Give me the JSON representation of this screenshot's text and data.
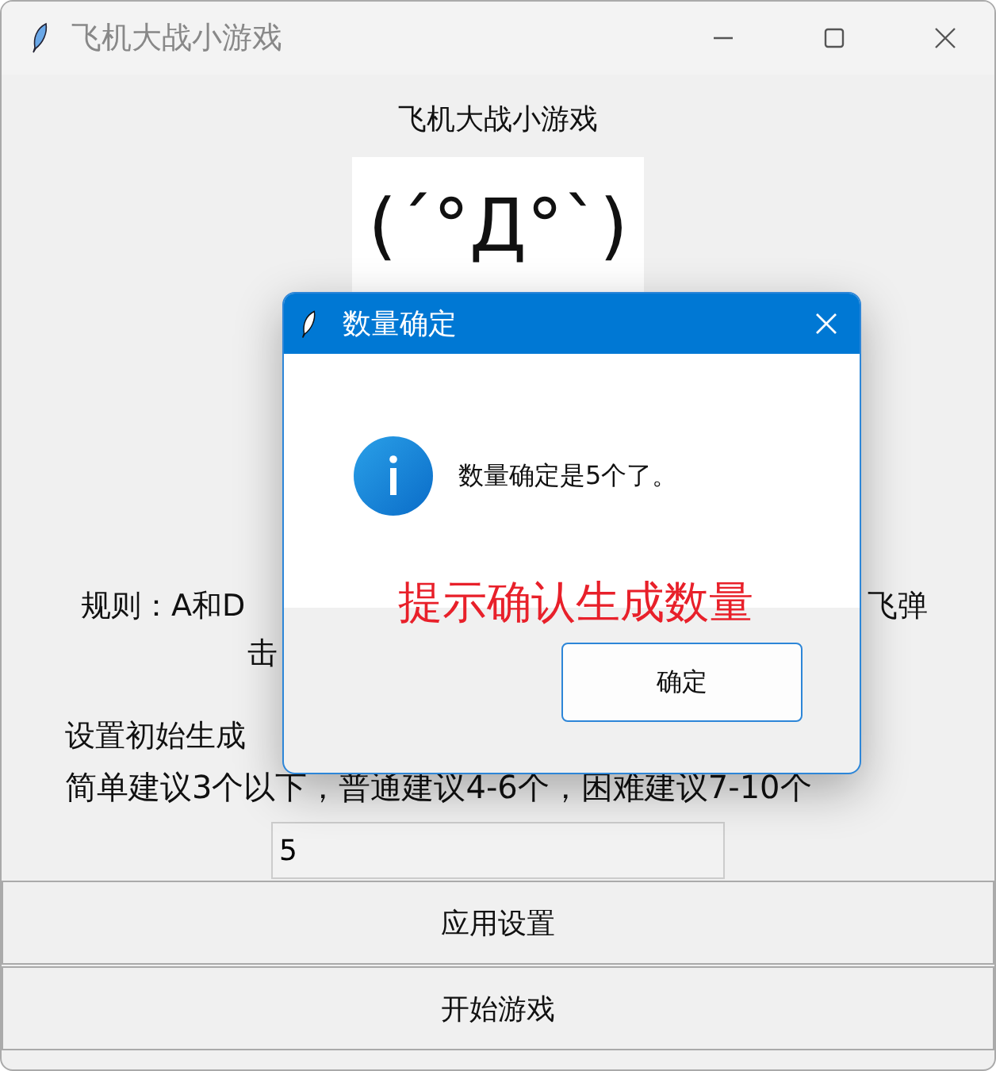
{
  "window": {
    "title": "飞机大战小游戏"
  },
  "heading": "飞机大战小游戏",
  "face": "(´°Д°`)",
  "rules": {
    "line_1_left": "规则：A和D",
    "line_1_right": "飞弹",
    "line_2": "击"
  },
  "setting_label": "设置初始生成",
  "hint": "简单建议3个以下，普通建议4-6个，困难建议7-10个",
  "count_field": {
    "value": "5"
  },
  "buttons": [
    "应用设置",
    "开始游戏"
  ],
  "dialog": {
    "title": "数量确定",
    "message": "数量确定是5个了。",
    "button": "确定"
  },
  "annotation": "提示确认生成数量"
}
